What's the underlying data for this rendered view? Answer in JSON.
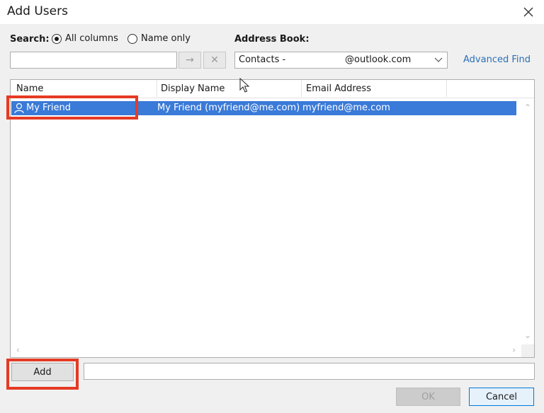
{
  "window": {
    "title": "Add Users"
  },
  "search": {
    "label": "Search:",
    "option_all": "All columns",
    "option_name": "Name only",
    "selected": "All columns",
    "value": "",
    "go_icon": "arrow-right-icon",
    "clear_icon": "close-icon"
  },
  "address_book": {
    "label": "Address Book:",
    "value_prefix": "Contacts - ",
    "value_suffix": "@outlook.com"
  },
  "advanced_find": "Advanced Find",
  "columns": [
    "Name",
    "Display Name",
    "Email Address"
  ],
  "rows": [
    {
      "name": "My Friend",
      "display_name": "My Friend (myfriend@me.com)",
      "email": "myfriend@me.com",
      "selected": true
    }
  ],
  "add_button": "Add",
  "add_field_value": "",
  "ok_button": "OK",
  "cancel_button": "Cancel",
  "colors": {
    "selection": "#3a7ad8",
    "highlight_box": "#e53a24",
    "link": "#2a6fb5"
  }
}
